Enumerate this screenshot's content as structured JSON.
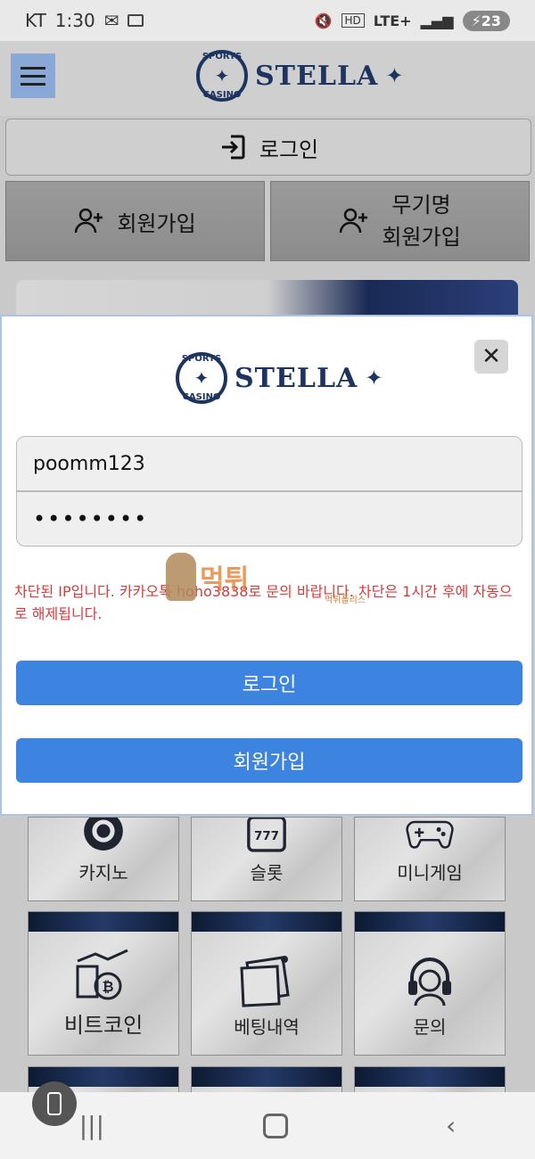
{
  "status_bar": {
    "carrier": "KT",
    "time": "1:30",
    "network": "LTE+",
    "battery": "23"
  },
  "header": {
    "logo_text": "STELLA",
    "logo_circle_top": "SPORTS",
    "logo_circle_bottom": "CASINO"
  },
  "auth": {
    "login_label": "로그인",
    "join_label": "회원가입",
    "anon_join_line1": "무기명",
    "anon_join_line2": "회원가입"
  },
  "modal": {
    "username_value": "poomm123",
    "password_value": "••••••••",
    "error_message": "차단된 IP입니다. 카카오톡 hoho3838로 문의 바랍니다. 차단은 1시간 후에 자동으로 해제됩니다.",
    "login_button": "로그인",
    "join_button": "회원가입",
    "close_symbol": "✕"
  },
  "watermark": {
    "text": "먹튀",
    "sub": "먹튀폴리스"
  },
  "tiles": [
    {
      "label": "카지노",
      "icon": "poker-chip-icon"
    },
    {
      "label": "슬롯",
      "icon": "slot-machine-icon"
    },
    {
      "label": "미니게임",
      "icon": "gamepad-icon"
    },
    {
      "label": "비트코인",
      "icon": "bitcoin-icon"
    },
    {
      "label": "베팅내역",
      "icon": "notes-icon"
    },
    {
      "label": "문의",
      "icon": "headset-icon"
    }
  ],
  "colors": {
    "brand_navy": "#1d3461",
    "button_blue": "#3c84e0",
    "error_red": "#d23c3c"
  }
}
